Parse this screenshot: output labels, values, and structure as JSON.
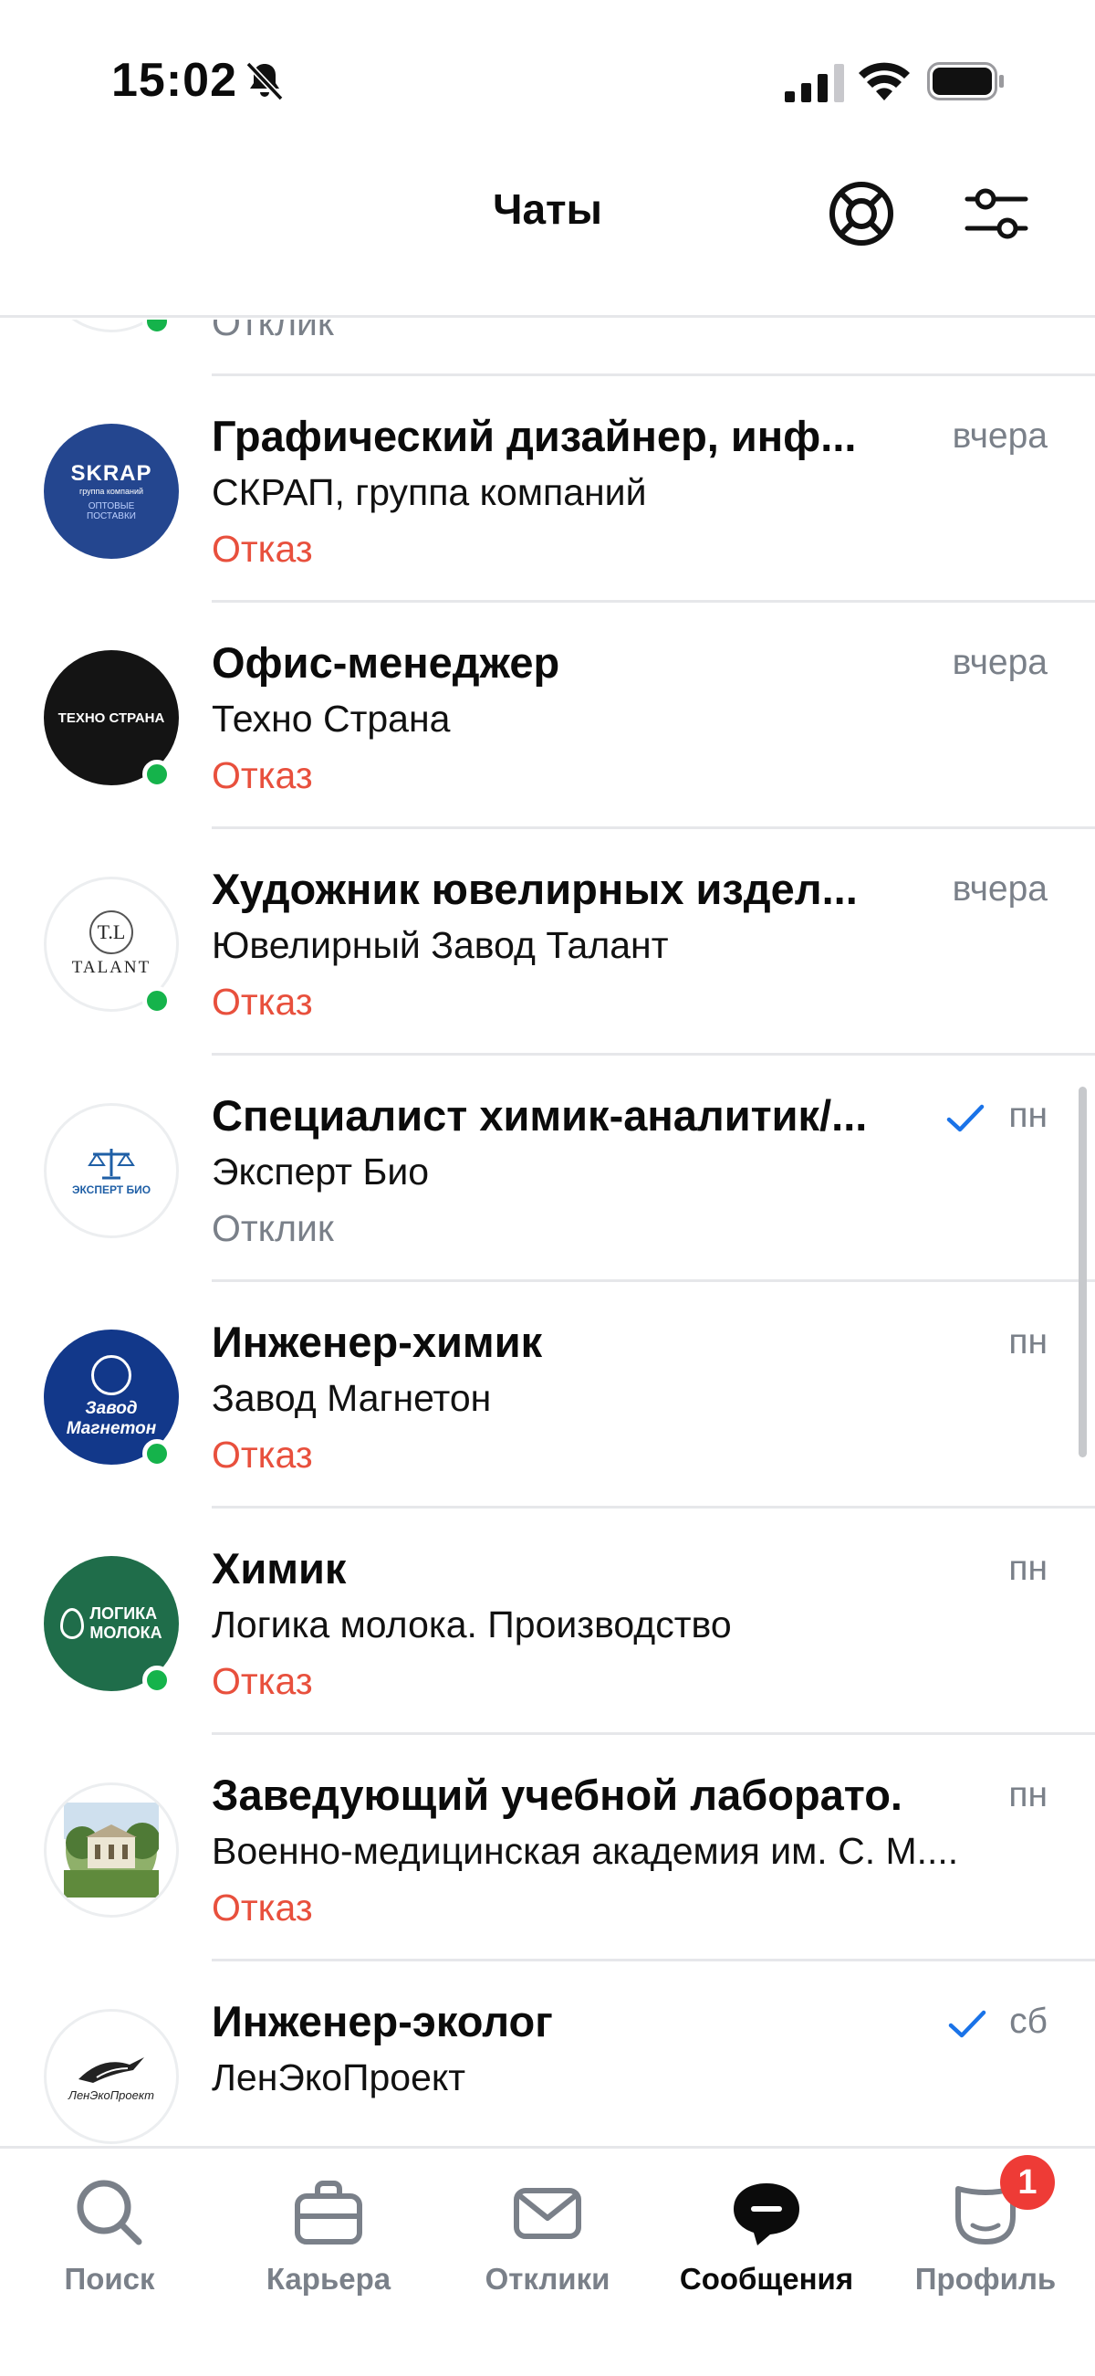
{
  "status_bar": {
    "time": "15:02"
  },
  "header": {
    "title": "Чаты"
  },
  "colors": {
    "reject": "#e8503d",
    "muted": "#7a8089",
    "online": "#15b34b",
    "check": "#1a73e8",
    "badge": "#ee3b36"
  },
  "chats": [
    {
      "title": "",
      "company": "",
      "status": "Отклик",
      "time": ""
    },
    {
      "title": "Графический дизайнер, инф...",
      "company": "СКРАП, группа компаний",
      "status": "Отказ",
      "time": "вчера",
      "avatar_text": [
        "SKRAP",
        "группа компаний",
        "ОПТОВЫЕ",
        "ПОСТАВКИ"
      ]
    },
    {
      "title": "Офис-менеджер",
      "company": "Техно Страна",
      "status": "Отказ",
      "time": "вчера",
      "avatar_text": "ТЕХНО СТРАНА"
    },
    {
      "title": "Художник ювелирных издел...",
      "company": "Ювелирный Завод Талант",
      "status": "Отказ",
      "time": "вчера",
      "avatar_text": [
        "T.L",
        "TALANT"
      ]
    },
    {
      "title": "Специалист химик-аналитик/...",
      "company": "Эксперт Био",
      "status": "Отклик",
      "time": "пн",
      "avatar_text": "ЭКСПЕРТ БИО"
    },
    {
      "title": "Инженер-химик",
      "company": "Завод Магнетон",
      "status": "Отказ",
      "time": "пн",
      "avatar_text": [
        "Завод",
        "Магнетон"
      ]
    },
    {
      "title": "Химик",
      "company": "Логика молока. Производство",
      "status": "Отказ",
      "time": "пн",
      "avatar_text": [
        "ЛОГИКА",
        "МОЛОКА"
      ]
    },
    {
      "title": "Заведующий учебной лаборато...",
      "company": "Военно-медицинская академия им. С. М....",
      "status": "Отказ",
      "time": "пн"
    },
    {
      "title": "Инженер-эколог",
      "company": "ЛенЭкоПроект",
      "status": "",
      "time": "сб",
      "avatar_text": "ЛенЭкоПроект"
    }
  ],
  "tabs": [
    {
      "label": "Поиск",
      "icon": "search-icon"
    },
    {
      "label": "Карьера",
      "icon": "briefcase-icon"
    },
    {
      "label": "Отклики",
      "icon": "envelope-icon"
    },
    {
      "label": "Сообщения",
      "icon": "chat-bubble-icon",
      "active": true
    },
    {
      "label": "Профиль",
      "icon": "profile-mask-icon"
    }
  ],
  "profile_badge": "1"
}
